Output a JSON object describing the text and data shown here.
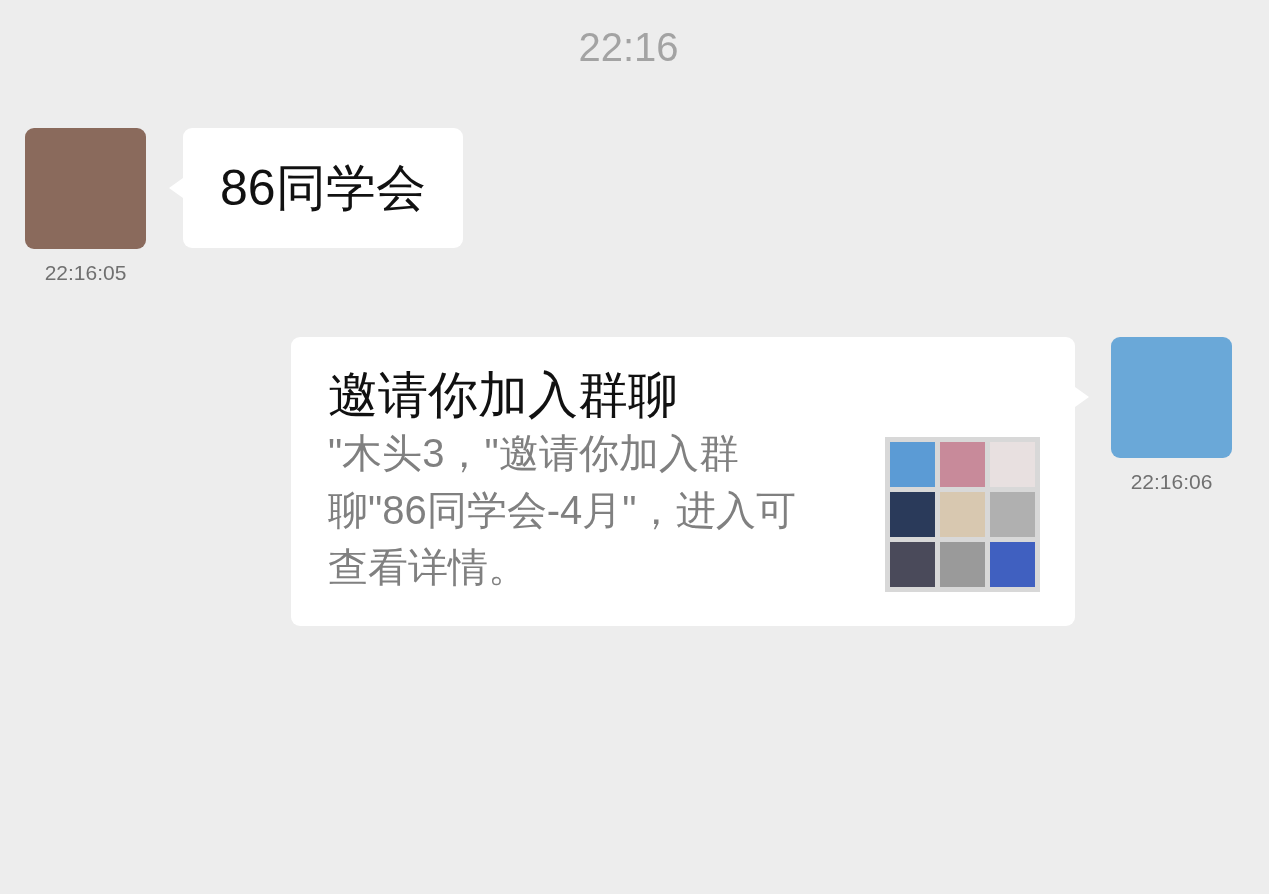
{
  "time_divider": "22:16",
  "messages": [
    {
      "outgoing": false,
      "kind": "text",
      "text": "86同学会",
      "timestamp": "22:16:05"
    },
    {
      "outgoing": true,
      "kind": "invite",
      "title": "邀请你加入群聊",
      "description": "\"木头3，\"邀请你加入群聊\"86同学会-4月\"，进入可查看详情。",
      "timestamp": "22:16:06"
    }
  ]
}
